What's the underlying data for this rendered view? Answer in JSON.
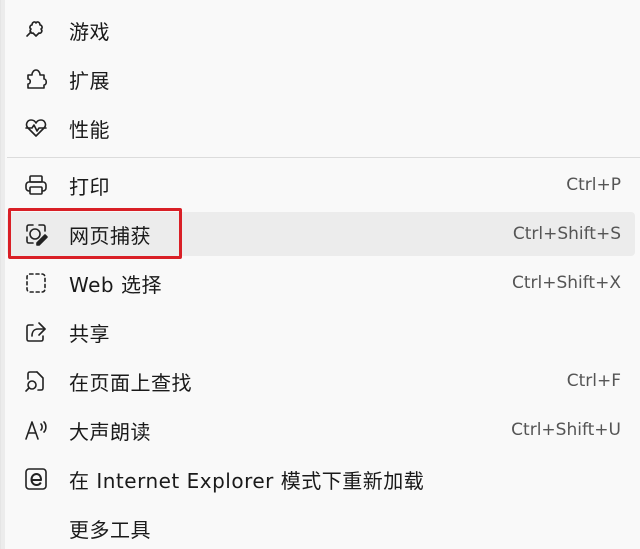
{
  "menu": {
    "items": [
      {
        "label": "游戏",
        "shortcut": "",
        "icon": "games-icon"
      },
      {
        "label": "扩展",
        "shortcut": "",
        "icon": "extensions-icon"
      },
      {
        "label": "性能",
        "shortcut": "",
        "icon": "performance-icon"
      },
      {
        "label": "打印",
        "shortcut": "Ctrl+P",
        "icon": "print-icon"
      },
      {
        "label": "网页捕获",
        "shortcut": "Ctrl+Shift+S",
        "icon": "web-capture-icon"
      },
      {
        "label": "Web 选择",
        "shortcut": "Ctrl+Shift+X",
        "icon": "web-select-icon"
      },
      {
        "label": "共享",
        "shortcut": "",
        "icon": "share-icon"
      },
      {
        "label": "在页面上查找",
        "shortcut": "Ctrl+F",
        "icon": "find-icon"
      },
      {
        "label": "大声朗读",
        "shortcut": "Ctrl+Shift+U",
        "icon": "read-aloud-icon"
      },
      {
        "label": "在 Internet Explorer 模式下重新加载",
        "shortcut": "",
        "icon": "ie-icon"
      },
      {
        "label": "更多工具",
        "shortcut": "",
        "icon": ""
      }
    ],
    "highlight_color": "#d91f26"
  }
}
